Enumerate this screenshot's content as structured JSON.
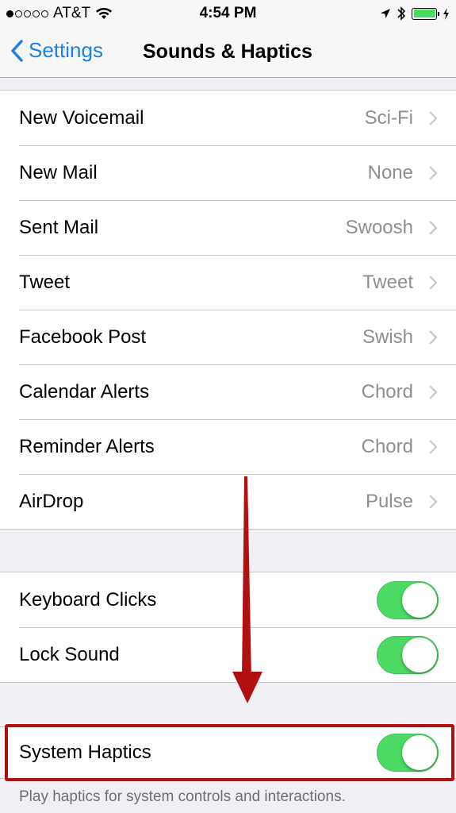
{
  "status_bar": {
    "signal_bars_filled": 1,
    "signal_bars_total": 5,
    "carrier": "AT&T",
    "time": "4:54 PM",
    "battery_color": "#4cd964",
    "icons": [
      "wifi-icon",
      "location-icon",
      "bluetooth-icon",
      "battery-icon",
      "charging-icon"
    ]
  },
  "nav": {
    "back_label": "Settings",
    "title": "Sounds & Haptics"
  },
  "sounds": [
    {
      "label": "New Voicemail",
      "value": "Sci-Fi"
    },
    {
      "label": "New Mail",
      "value": "None"
    },
    {
      "label": "Sent Mail",
      "value": "Swoosh"
    },
    {
      "label": "Tweet",
      "value": "Tweet"
    },
    {
      "label": "Facebook Post",
      "value": "Swish"
    },
    {
      "label": "Calendar Alerts",
      "value": "Chord"
    },
    {
      "label": "Reminder Alerts",
      "value": "Chord"
    },
    {
      "label": "AirDrop",
      "value": "Pulse"
    }
  ],
  "toggles": [
    {
      "label": "Keyboard Clicks",
      "on": true
    },
    {
      "label": "Lock Sound",
      "on": true
    }
  ],
  "haptics": {
    "label": "System Haptics",
    "on": true,
    "footnote": "Play haptics for system controls and interactions."
  },
  "annotation": {
    "color": "#b01010",
    "type": "arrow-and-highlight"
  },
  "colors": {
    "accent": "#1a82e0",
    "toggle_on": "#4cd964",
    "background": "#efeff4"
  }
}
